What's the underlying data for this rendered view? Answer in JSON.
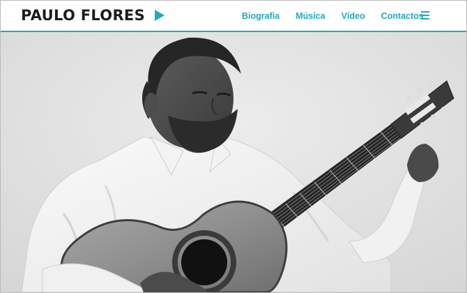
{
  "brand": {
    "name": "PAULO FLORES",
    "icon": "play-triangle-icon",
    "accent_color": "#22a9bf"
  },
  "nav": {
    "items": [
      {
        "label": "Biografia"
      },
      {
        "label": "Música"
      },
      {
        "label": "Vídeo"
      },
      {
        "label": "Contactos"
      }
    ],
    "menu_icon": "hamburger-menu-icon"
  },
  "hero": {
    "image": "black-and-white photo of a man in a white shirt playing an acoustic guitar"
  }
}
